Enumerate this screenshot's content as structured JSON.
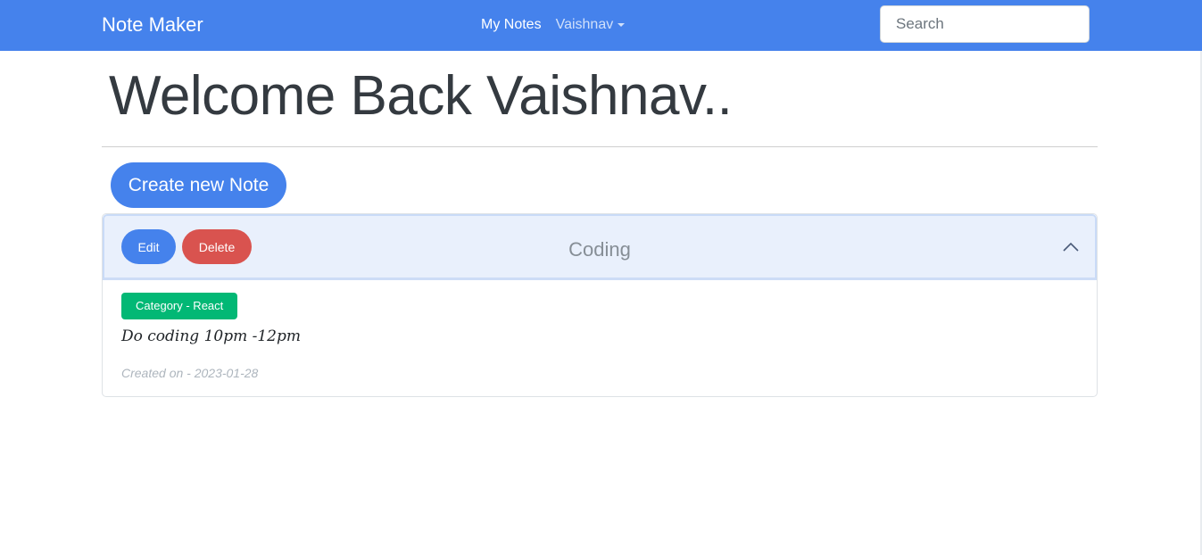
{
  "navbar": {
    "brand": "Note Maker",
    "links": {
      "my_notes": "My Notes",
      "user": "Vaishnav"
    },
    "search": {
      "placeholder": "Search",
      "value": ""
    }
  },
  "page": {
    "title": "Welcome Back Vaishnav..",
    "create_button": "Create new Note"
  },
  "notes": [
    {
      "title": "Coding",
      "edit_label": "Edit",
      "delete_label": "Delete",
      "category_badge": "Category - React",
      "content": "Do coding 10pm -12pm",
      "created": "Created on - 2023-01-28"
    }
  ],
  "colors": {
    "primary": "#4582ec",
    "danger": "#d9534f",
    "success": "#02b875",
    "header_bg": "#e9f0fc"
  },
  "icons": {
    "caret": "caret-down-icon",
    "collapse": "chevron-up-icon"
  }
}
